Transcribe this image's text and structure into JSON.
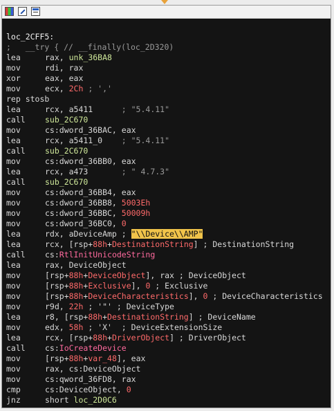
{
  "lines": [
    {
      "label": "loc_2CFF5:"
    },
    {
      "comment": ";   __try { // __finally(loc_2D320)"
    },
    {
      "mn": "lea",
      "ops": [
        {
          "t": "rax, "
        },
        {
          "t": "unk_36BA8",
          "c": "name"
        }
      ]
    },
    {
      "mn": "mov",
      "ops": [
        {
          "t": "rdi, rax"
        }
      ]
    },
    {
      "mn": "xor",
      "ops": [
        {
          "t": "eax, eax"
        }
      ]
    },
    {
      "mn": "mov",
      "ops": [
        {
          "t": "ecx, "
        },
        {
          "t": "2Ch",
          "c": "num"
        },
        {
          "t": " ; ','",
          "c": "cmt"
        }
      ]
    },
    {
      "mn": "rep stosb",
      "ops": []
    },
    {
      "mn": "lea",
      "ops": [
        {
          "t": "rcx, a5411      "
        },
        {
          "t": "; \"5.4.11\"",
          "c": "cmt"
        }
      ]
    },
    {
      "mn": "call",
      "ops": [
        {
          "t": "sub_2C670",
          "c": "name"
        }
      ]
    },
    {
      "mn": "mov",
      "ops": [
        {
          "t": "cs:dword_36BAC, eax"
        }
      ]
    },
    {
      "mn": "lea",
      "ops": [
        {
          "t": "rcx, a5411_0    "
        },
        {
          "t": "; \"5.4.11\"",
          "c": "cmt"
        }
      ]
    },
    {
      "mn": "call",
      "ops": [
        {
          "t": "sub_2C670",
          "c": "name"
        }
      ]
    },
    {
      "mn": "mov",
      "ops": [
        {
          "t": "cs:dword_36BB0, eax"
        }
      ]
    },
    {
      "mn": "lea",
      "ops": [
        {
          "t": "rcx, a473       "
        },
        {
          "t": "; \" 4.7.3\"",
          "c": "cmt"
        }
      ]
    },
    {
      "mn": "call",
      "ops": [
        {
          "t": "sub_2C670",
          "c": "name"
        }
      ]
    },
    {
      "mn": "mov",
      "ops": [
        {
          "t": "cs:dword_36BB4, eax"
        }
      ]
    },
    {
      "mn": "mov",
      "ops": [
        {
          "t": "cs:dword_36BB8, "
        },
        {
          "t": "5003Eh",
          "c": "num"
        }
      ]
    },
    {
      "mn": "mov",
      "ops": [
        {
          "t": "cs:dword_36BBC, "
        },
        {
          "t": "50009h",
          "c": "num"
        }
      ]
    },
    {
      "mn": "mov",
      "ops": [
        {
          "t": "cs:dword_36BC0, "
        },
        {
          "t": "0",
          "c": "num"
        }
      ]
    },
    {
      "mn": "lea",
      "ops": [
        {
          "t": "rdx, aDeviceAmp ; "
        },
        {
          "t": "\"\\\\Device\\\\AMP\"",
          "c": "hl"
        }
      ]
    },
    {
      "mn": "lea",
      "ops": [
        {
          "t": "rcx, [rsp+"
        },
        {
          "t": "88h",
          "c": "num"
        },
        {
          "t": "+"
        },
        {
          "t": "DestinationString",
          "c": "num"
        },
        {
          "t": "] ; DestinationString"
        }
      ]
    },
    {
      "mn": "call",
      "ops": [
        {
          "t": "cs:"
        },
        {
          "t": "RtlInitUnicodeString",
          "c": "fn"
        }
      ]
    },
    {
      "mn": "lea",
      "ops": [
        {
          "t": "rax, DeviceObject"
        }
      ]
    },
    {
      "mn": "mov",
      "ops": [
        {
          "t": "[rsp+"
        },
        {
          "t": "88h",
          "c": "num"
        },
        {
          "t": "+"
        },
        {
          "t": "DeviceObject",
          "c": "num"
        },
        {
          "t": "], rax ; DeviceObject"
        }
      ]
    },
    {
      "mn": "mov",
      "ops": [
        {
          "t": "[rsp+"
        },
        {
          "t": "88h",
          "c": "num"
        },
        {
          "t": "+"
        },
        {
          "t": "Exclusive",
          "c": "num"
        },
        {
          "t": "], "
        },
        {
          "t": "0",
          "c": "num"
        },
        {
          "t": " ; Exclusive"
        }
      ]
    },
    {
      "mn": "mov",
      "ops": [
        {
          "t": "[rsp+"
        },
        {
          "t": "88h",
          "c": "num"
        },
        {
          "t": "+"
        },
        {
          "t": "DeviceCharacteristics",
          "c": "num"
        },
        {
          "t": "], "
        },
        {
          "t": "0",
          "c": "num"
        },
        {
          "t": " ; DeviceCharacteristics"
        }
      ]
    },
    {
      "mn": "mov",
      "ops": [
        {
          "t": "r9d, "
        },
        {
          "t": "22h",
          "c": "num"
        },
        {
          "t": " ; '\"' ; DeviceType"
        }
      ]
    },
    {
      "mn": "lea",
      "ops": [
        {
          "t": "r8, [rsp+"
        },
        {
          "t": "88h",
          "c": "num"
        },
        {
          "t": "+"
        },
        {
          "t": "DestinationString",
          "c": "num"
        },
        {
          "t": "] ; DeviceName"
        }
      ]
    },
    {
      "mn": "mov",
      "ops": [
        {
          "t": "edx, "
        },
        {
          "t": "58h",
          "c": "num"
        },
        {
          "t": " ; 'X'  ; DeviceExtensionSize"
        }
      ]
    },
    {
      "mn": "lea",
      "ops": [
        {
          "t": "rcx, [rsp+"
        },
        {
          "t": "88h",
          "c": "num"
        },
        {
          "t": "+"
        },
        {
          "t": "DriverObject",
          "c": "num"
        },
        {
          "t": "] ; DriverObject"
        }
      ]
    },
    {
      "mn": "call",
      "ops": [
        {
          "t": "cs:"
        },
        {
          "t": "IoCreateDevice",
          "c": "fn"
        }
      ]
    },
    {
      "mn": "mov",
      "ops": [
        {
          "t": "[rsp+"
        },
        {
          "t": "88h",
          "c": "num"
        },
        {
          "t": "+"
        },
        {
          "t": "var_48",
          "c": "num"
        },
        {
          "t": "], eax"
        }
      ]
    },
    {
      "mn": "mov",
      "ops": [
        {
          "t": "rax, cs:DeviceObject"
        }
      ]
    },
    {
      "mn": "mov",
      "ops": [
        {
          "t": "cs:qword_36FD8, rax"
        }
      ]
    },
    {
      "mn": "cmp",
      "ops": [
        {
          "t": "cs:DeviceObject, "
        },
        {
          "t": "0",
          "c": "num"
        }
      ]
    },
    {
      "mn": "jnz",
      "ops": [
        {
          "t": "short "
        },
        {
          "t": "loc_2D0C6",
          "c": "name"
        }
      ]
    }
  ]
}
